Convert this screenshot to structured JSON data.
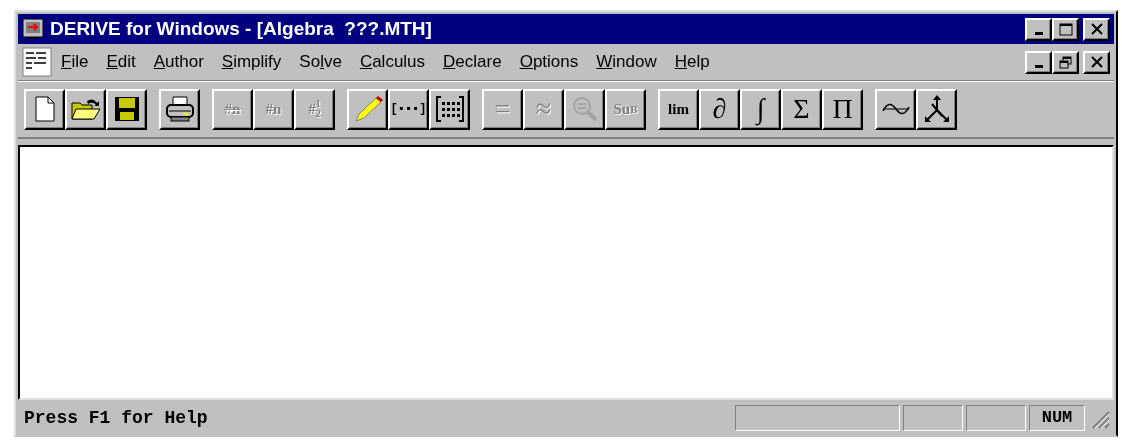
{
  "window": {
    "title": "DERIVE for Windows - [Algebra  ???.MTH]"
  },
  "menu": [
    {
      "access_key": "F",
      "after": "ile"
    },
    {
      "access_key": "E",
      "after": "dit"
    },
    {
      "access_key": "A",
      "after": "uthor"
    },
    {
      "access_key": "S",
      "after": "implify"
    },
    {
      "before": "So",
      "access_key": "l",
      "after": "ve"
    },
    {
      "access_key": "C",
      "after": "alculus"
    },
    {
      "access_key": "D",
      "after": "eclare"
    },
    {
      "access_key": "O",
      "after": "ptions"
    },
    {
      "access_key": "W",
      "after": "indow"
    },
    {
      "access_key": "H",
      "after": "elp"
    }
  ],
  "toolbar": [
    [
      {
        "kind": "new",
        "disabled": false
      },
      {
        "kind": "open",
        "disabled": false
      },
      {
        "kind": "save",
        "disabled": false
      }
    ],
    [
      {
        "kind": "print",
        "disabled": false
      }
    ],
    [
      {
        "kind": "glyph-crossed",
        "label": "#n",
        "disabled": true
      },
      {
        "kind": "glyph",
        "label": "#n",
        "disabled": true
      },
      {
        "kind": "fraction",
        "label": "#",
        "numerator": "1",
        "denominator": "2",
        "disabled": true
      }
    ],
    [
      {
        "kind": "pencil",
        "disabled": false
      },
      {
        "kind": "glyph",
        "label": "[▪▪▪]",
        "disabled": false
      },
      {
        "kind": "matrix",
        "disabled": false
      }
    ],
    [
      {
        "kind": "glyph",
        "label": "=",
        "disabled": true
      },
      {
        "kind": "glyph",
        "label": "≈",
        "disabled": true
      },
      {
        "kind": "zoom",
        "disabled": true
      },
      {
        "kind": "sub",
        "label": "Su",
        "sub": "B",
        "disabled": true
      }
    ],
    [
      {
        "kind": "glyph",
        "label": "lim",
        "disabled": false
      },
      {
        "kind": "glyph",
        "label": "∂",
        "disabled": false
      },
      {
        "kind": "glyph",
        "label": "∫",
        "disabled": false
      },
      {
        "kind": "glyph",
        "label": "Σ",
        "disabled": false
      },
      {
        "kind": "glyph",
        "label": "Π",
        "disabled": false
      }
    ],
    [
      {
        "kind": "plot2d",
        "disabled": false
      },
      {
        "kind": "plot3d",
        "disabled": false
      }
    ]
  ],
  "status_bar": {
    "message": "Press F1 for Help",
    "panels": [
      {
        "kind": "empty"
      },
      {
        "kind": "empty"
      },
      {
        "kind": "empty"
      },
      {
        "kind": "text",
        "text": "NUM"
      }
    ]
  }
}
